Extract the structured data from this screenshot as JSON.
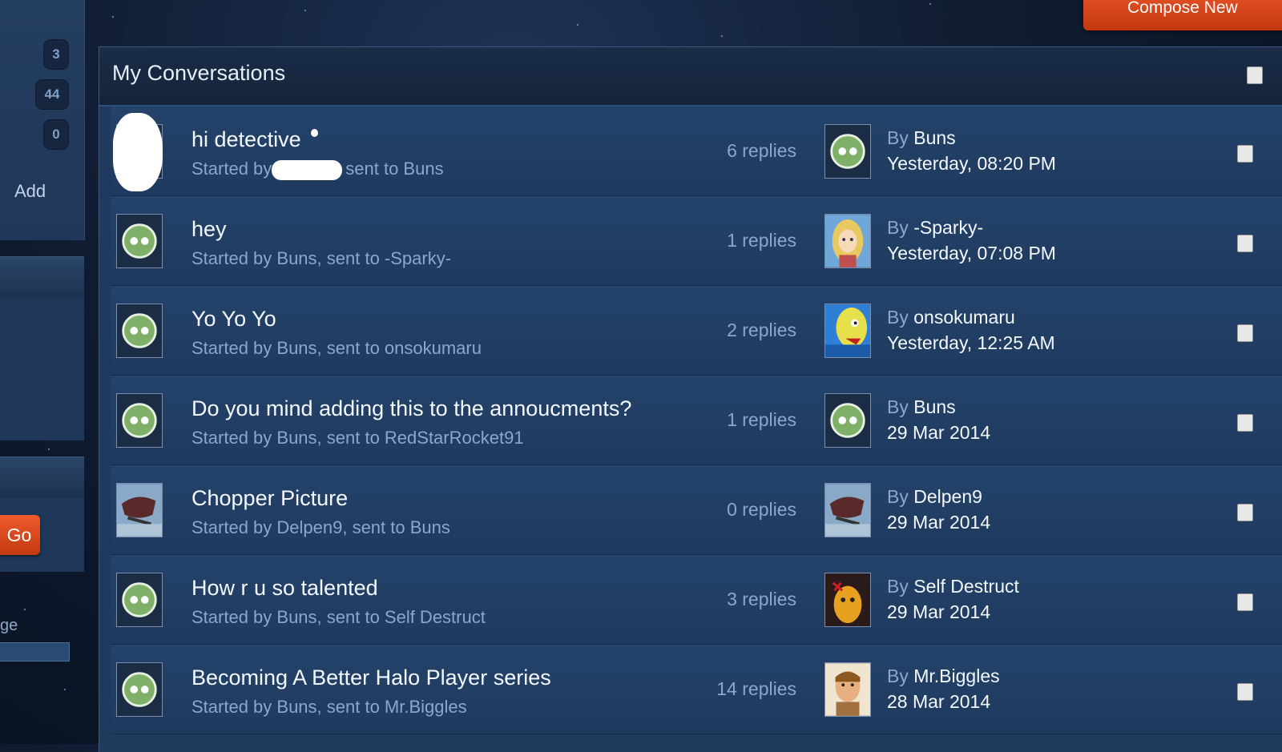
{
  "sidebar": {
    "counts": [
      "3",
      "44",
      "0"
    ],
    "add_label": "Add",
    "partial_label": "ge",
    "go_label": "Go"
  },
  "toolbar": {
    "compose_label": "Compose New"
  },
  "panel": {
    "title": "My Conversations"
  },
  "colors": {
    "accent": "#d9461a",
    "panel": "#1f3a5c",
    "header": "#16263f"
  },
  "conversations": [
    {
      "title": "hi detective",
      "subtitle_start": "Started by",
      "subtitle_end": "sent to Buns",
      "replies": "6 replies",
      "by_prefix": "By",
      "by_name": "Buns",
      "date": "Yesterday, 08:20 PM",
      "starter_icon": "redacted-avatar",
      "last_icon": "green-face-icon"
    },
    {
      "title": "hey",
      "subtitle": "Started by Buns, sent to -Sparky-",
      "replies": "1 replies",
      "by_prefix": "By",
      "by_name": "-Sparky-",
      "date": "Yesterday, 07:08 PM",
      "starter_icon": "green-face-icon",
      "last_icon": "blonde-girl-avatar"
    },
    {
      "title": "Yo Yo Yo",
      "subtitle": "Started by Buns, sent to onsokumaru",
      "replies": "2 replies",
      "by_prefix": "By",
      "by_name": "onsokumaru",
      "date": "Yesterday, 12:25 AM",
      "starter_icon": "green-face-icon",
      "last_icon": "yellow-creature-avatar"
    },
    {
      "title": "Do you mind adding this to the annoucments?",
      "subtitle": "Started by Buns, sent to RedStarRocket91",
      "replies": "1 replies",
      "by_prefix": "By",
      "by_name": "Buns",
      "date": "29 Mar 2014",
      "starter_icon": "green-face-icon",
      "last_icon": "green-face-icon"
    },
    {
      "title": "Chopper Picture",
      "subtitle": "Started by Delpen9, sent to Buns",
      "replies": "0 replies",
      "by_prefix": "By",
      "by_name": "Delpen9",
      "date": "29 Mar 2014",
      "starter_icon": "chopper-avatar",
      "last_icon": "chopper-avatar"
    },
    {
      "title": "How r u so talented",
      "subtitle": "Started by Buns, sent to Self Destruct",
      "replies": "3 replies",
      "by_prefix": "By",
      "by_name": "Self Destruct",
      "date": "29 Mar 2014",
      "starter_icon": "green-face-icon",
      "last_icon": "orange-robot-avatar"
    },
    {
      "title": "Becoming A Better Halo Player series",
      "subtitle": "Started by Buns, sent to Mr.Biggles",
      "replies": "14 replies",
      "by_prefix": "By",
      "by_name": "Mr.Biggles",
      "date": "28 Mar 2014",
      "starter_icon": "green-face-icon",
      "last_icon": "cartoon-man-avatar"
    }
  ]
}
